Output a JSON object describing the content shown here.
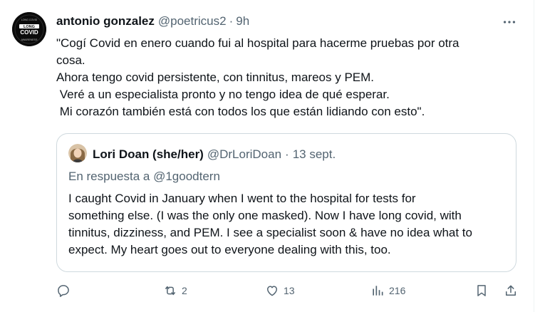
{
  "author": {
    "name": "antonio gonzalez",
    "handle": "@poetricus2",
    "separator": "·",
    "time": "9h",
    "avatar_text": {
      "top": "LONG COVID",
      "ribbon": "LONG",
      "main": "COVID",
      "bottom": "AWARENESS"
    }
  },
  "tweet": {
    "lines": [
      "\"Cogí Covid en enero cuando fui al hospital para hacerme pruebas por otra",
      "cosa.",
      "Ahora tengo covid persistente, con tinnitus, mareos y PEM.",
      " Veré a un especialista pronto y no tengo idea de qué esperar.",
      " Mi corazón también está con todos los que están lidiando con esto\"."
    ]
  },
  "quote": {
    "name": "Lori Doan (she/her)",
    "handle": "@DrLoriDoan",
    "separator": "·",
    "date": "13 sept.",
    "reply_prefix": "En respuesta a",
    "reply_to": "@1goodtern",
    "lines": [
      "I caught Covid in January when I went to the hospital for tests for",
      "something else. (I was the only one masked). Now I have long covid, with",
      "tinnitus, dizziness, and PEM. I see a specialist soon & have no idea what to",
      "expect. My heart goes out to everyone dealing with this, too."
    ]
  },
  "actions": {
    "reply_count": "",
    "retweet_count": "2",
    "like_count": "13",
    "views_count": "216"
  },
  "icons": {
    "more": "more-horizontal-icon",
    "reply": "reply-icon",
    "retweet": "retweet-icon",
    "like": "heart-icon",
    "views": "analytics-icon",
    "bookmark": "bookmark-icon",
    "share": "share-icon"
  },
  "colors": {
    "text": "#0f1419",
    "secondary": "#536471",
    "border": "#cfd9de"
  }
}
